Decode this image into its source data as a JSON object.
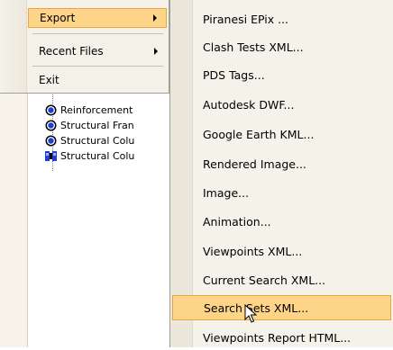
{
  "menu": {
    "items": [
      {
        "label": "Export",
        "has_submenu": true,
        "highlighted": true
      },
      {
        "label": "Recent Files",
        "has_submenu": true,
        "highlighted": false
      },
      {
        "label": "Exit",
        "has_submenu": false,
        "highlighted": false
      }
    ]
  },
  "submenu": {
    "items": [
      {
        "label": "Piranesi EPix ..."
      },
      {
        "label": "Clash Tests XML..."
      },
      {
        "label": "PDS Tags..."
      },
      {
        "label": "Autodesk DWF..."
      },
      {
        "label": "Google Earth KML..."
      },
      {
        "label": "Rendered Image..."
      },
      {
        "label": "Image..."
      },
      {
        "label": "Animation..."
      },
      {
        "label": "Viewpoints XML..."
      },
      {
        "label": "Current Search XML..."
      },
      {
        "label": "Search Sets XML..."
      },
      {
        "label": "Viewpoints Report HTML..."
      }
    ],
    "highlighted_label": "Search Sets XML..."
  },
  "tree": {
    "items": [
      {
        "label": "Reinforcement",
        "icon": "search-set-icon"
      },
      {
        "label": "Structural Fran",
        "icon": "search-set-icon"
      },
      {
        "label": "Structural Colu",
        "icon": "search-set-icon"
      },
      {
        "label": "Structural Colu",
        "icon": "selection-set-icon"
      }
    ]
  },
  "colors": {
    "highlight": "#fdd488",
    "highlight_border": "#e3a83f",
    "menu_bg": "#f5f2ea"
  }
}
